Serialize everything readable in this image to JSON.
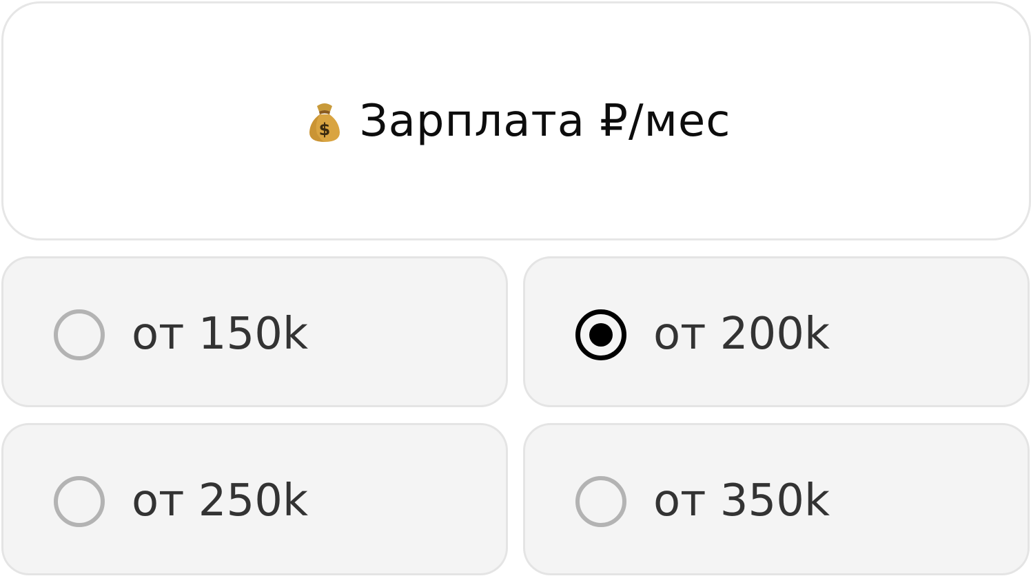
{
  "header": {
    "icon": "money-bag-icon",
    "title": "Зарплата ₽/мес"
  },
  "options": [
    {
      "label": "от 150k",
      "selected": false
    },
    {
      "label": "от 200k",
      "selected": true
    },
    {
      "label": "от 250k",
      "selected": false
    },
    {
      "label": "от 350k",
      "selected": false
    }
  ],
  "colors": {
    "card_border": "#e6e6e6",
    "option_bg": "#f4f4f4",
    "radio_unchecked": "#b3b3b3",
    "radio_checked": "#000000",
    "text": "#333333"
  }
}
